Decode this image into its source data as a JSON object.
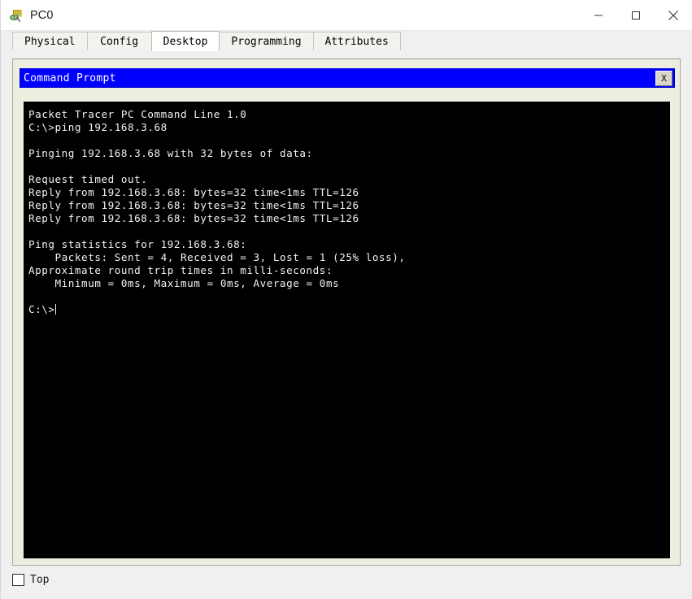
{
  "window": {
    "title": "PC0",
    "icon": "pc-device-icon",
    "controls": {
      "minimize": "minimize-icon",
      "maximize": "maximize-icon",
      "close": "close-icon"
    }
  },
  "tabs": [
    {
      "label": "Physical",
      "active": false
    },
    {
      "label": "Config",
      "active": false
    },
    {
      "label": "Desktop",
      "active": true
    },
    {
      "label": "Programming",
      "active": false
    },
    {
      "label": "Attributes",
      "active": false
    }
  ],
  "cmd_window": {
    "title": "Command Prompt",
    "close_label": "X",
    "titlebar_color": "#0000ff",
    "terminal_bg": "#000000",
    "terminal_fg": "#f2f2f2"
  },
  "terminal": {
    "lines": [
      "Packet Tracer PC Command Line 1.0",
      "C:\\>ping 192.168.3.68",
      "",
      "Pinging 192.168.3.68 with 32 bytes of data:",
      "",
      "Request timed out.",
      "Reply from 192.168.3.68: bytes=32 time<1ms TTL=126",
      "Reply from 192.168.3.68: bytes=32 time<1ms TTL=126",
      "Reply from 192.168.3.68: bytes=32 time<1ms TTL=126",
      "",
      "Ping statistics for 192.168.3.68:",
      "    Packets: Sent = 4, Received = 3, Lost = 1 (25% loss),",
      "Approximate round trip times in milli-seconds:",
      "    Minimum = 0ms, Maximum = 0ms, Average = 0ms",
      "",
      "C:\\>"
    ],
    "prompt": "C:\\>",
    "ping_target": "192.168.3.68",
    "packet_size_bytes": "32",
    "stats": {
      "sent": "4",
      "received": "3",
      "lost": "1",
      "loss_percent": "25%",
      "minimum": "0ms",
      "maximum": "0ms",
      "average": "0ms",
      "ttl": "126",
      "time": "<1ms"
    }
  },
  "bottom": {
    "top_checkbox_label": "Top",
    "top_checkbox_checked": false
  }
}
